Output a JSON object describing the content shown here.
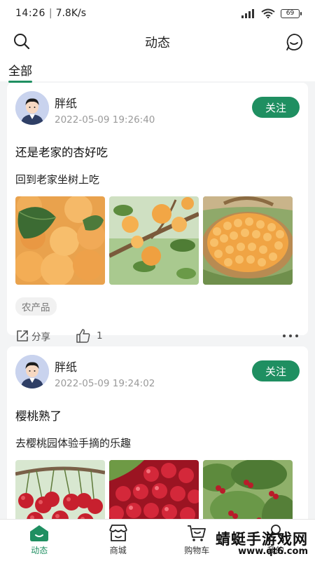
{
  "status": {
    "time": "14:26",
    "speed": "7.8K/s",
    "battery": "69"
  },
  "header": {
    "title": "动态"
  },
  "tabs": [
    {
      "label": "全部"
    }
  ],
  "posts": [
    {
      "author": "胖纸",
      "time": "2022-05-09 19:26:40",
      "follow_label": "关注",
      "title": "还是老家的杏好吃",
      "body": "回到老家坐树上吃",
      "tag": "农产品",
      "share_label": "分享",
      "like_count": "1",
      "images": [
        "apricot-photo",
        "apricot-tree-photo",
        "apricot-basket-photo"
      ]
    },
    {
      "author": "胖纸",
      "time": "2022-05-09 19:24:02",
      "follow_label": "关注",
      "title": "樱桃熟了",
      "body": "去樱桃园体验手摘的乐趣",
      "images": [
        "cherry-branch-photo",
        "cherry-pile-photo",
        "cherry-tree-photo"
      ]
    }
  ],
  "nav": [
    {
      "label": "动态",
      "icon": "home-icon",
      "active": true
    },
    {
      "label": "商城",
      "icon": "shop-icon"
    },
    {
      "label": "购物车",
      "icon": "cart-icon"
    },
    {
      "label": "我的",
      "icon": "user-icon"
    }
  ],
  "watermark": {
    "line1": "蜻蜓手游戏网",
    "line2": "www.qt6.com"
  },
  "colors": {
    "accent": "#1f8f61",
    "background": "#f3f4f5"
  }
}
